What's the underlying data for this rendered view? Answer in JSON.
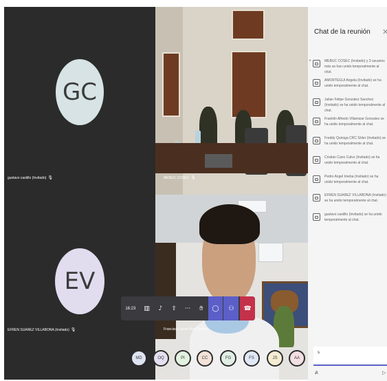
{
  "tiles": {
    "gc": {
      "initials": "GC",
      "name": "gustavo castillo (Invitado)"
    },
    "mebuc": {
      "name": "MEBUC COSEC"
    },
    "ev": {
      "initials": "EV",
      "name": "EFREN SUAREZ VILLABONA (Invitado)"
    },
    "francisco": {
      "name": "Francisco Javier Rey Chacon"
    }
  },
  "toolbar": {
    "timer": "16:23",
    "icons": [
      "camera-icon",
      "mic-off-icon",
      "share-icon",
      "more-icon",
      "raise-hand-icon",
      "chat-icon",
      "people-icon",
      "hang-up-icon"
    ]
  },
  "roster": [
    "MD",
    "OQ",
    "PI",
    "CC",
    "FG",
    "FS",
    "JS",
    "AA"
  ],
  "roster_colors": [
    "#dfe4f3",
    "#e4e0f0",
    "#e3f1e0",
    "#f3e2d8",
    "#e0eee6",
    "#e1e8f5",
    "#f6ecd3",
    "#f1dfe4"
  ],
  "chat": {
    "title": "Chat de la reunión",
    "close_icon": "close-icon",
    "messages": [
      "MEBUC COSEC (Invitado) y 3 usuarios más se han unido temporalmente al chat.",
      "AMORTEGUI Angela (Invitado) se ha unido temporalmente al chat.",
      "Julian Felipe Gonzalez Sanchez (Invitado) se ha unido temporalmente al chat.",
      "Franklin Alfredo Villamizar Gonzalez se ha unido temporalmente al chat.",
      "Freddy Quiroga CRC S/der (Invitado) se ha unido temporalmente al chat.",
      "Cristian Cano Calvo (Invitado) se ha unido temporalmente al chat.",
      "Pedro Angel Imeba (Invitado) se ha unido temporalmente al chat.",
      "EFREN SUAREZ VILLABONA (Invitado) se ha unido temporalmente al chat.",
      "gustavo castillo (Invitado) se ha unido temporalmente al chat."
    ],
    "compose_value": "s"
  },
  "colors": {
    "accent": "#5b5fc7",
    "hangup": "#c4314b",
    "tile_bg": "#2b2b2b"
  }
}
